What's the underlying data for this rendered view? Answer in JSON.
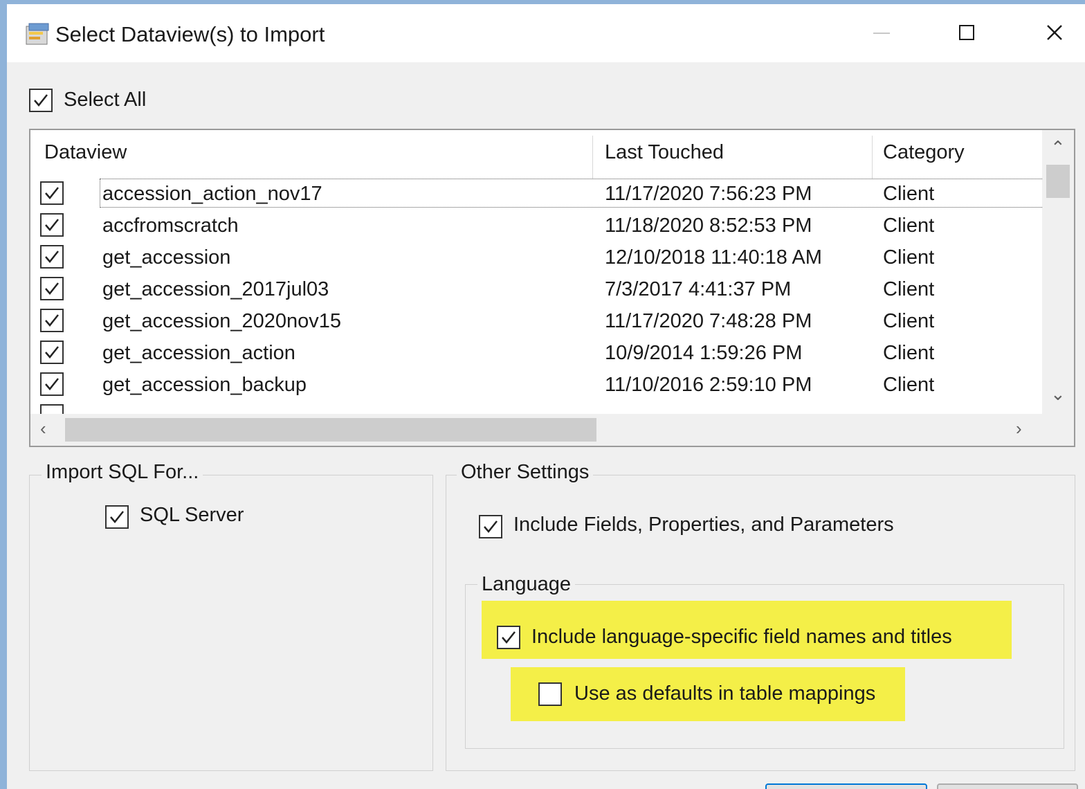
{
  "window": {
    "title": "Select Dataview(s) to Import",
    "minimize_icon": "minimize-icon",
    "maximize_icon": "maximize-icon",
    "close_icon": "close-icon"
  },
  "select_all": {
    "label": "Select All",
    "checked": true
  },
  "list": {
    "columns": [
      "Dataview",
      "Last Touched",
      "Category"
    ],
    "rows": [
      {
        "checked": true,
        "name": "accession_action_nov17",
        "last_touched": "11/17/2020 7:56:23 PM",
        "category": "Client"
      },
      {
        "checked": true,
        "name": "accfromscratch",
        "last_touched": "11/18/2020 8:52:53 PM",
        "category": "Client"
      },
      {
        "checked": true,
        "name": "get_accession",
        "last_touched": "12/10/2018 11:40:18 AM",
        "category": "Client"
      },
      {
        "checked": true,
        "name": "get_accession_2017jul03",
        "last_touched": "7/3/2017 4:41:37 PM",
        "category": "Client"
      },
      {
        "checked": true,
        "name": "get_accession_2020nov15",
        "last_touched": "11/17/2020 7:48:28 PM",
        "category": "Client"
      },
      {
        "checked": true,
        "name": "get_accession_action",
        "last_touched": "10/9/2014 1:59:26 PM",
        "category": "Client"
      },
      {
        "checked": true,
        "name": "get_accession_backup",
        "last_touched": "11/10/2016 2:59:10 PM",
        "category": "Client"
      }
    ]
  },
  "import_sql": {
    "title": "Import SQL For...",
    "sql_server": {
      "label": "SQL Server",
      "checked": true
    }
  },
  "other_settings": {
    "title": "Other Settings",
    "include_fields": {
      "label": "Include Fields, Properties, and Parameters",
      "checked": true
    },
    "language": {
      "title": "Language",
      "include_language": {
        "label": "Include language-specific field names and titles",
        "checked": true
      },
      "use_defaults": {
        "label": "Use as defaults in table mappings",
        "checked": false
      }
    }
  },
  "colors": {
    "highlight": "#f4ef48",
    "window_bg": "#f0f0f0",
    "desktop_bg": "#8fb3d9"
  }
}
